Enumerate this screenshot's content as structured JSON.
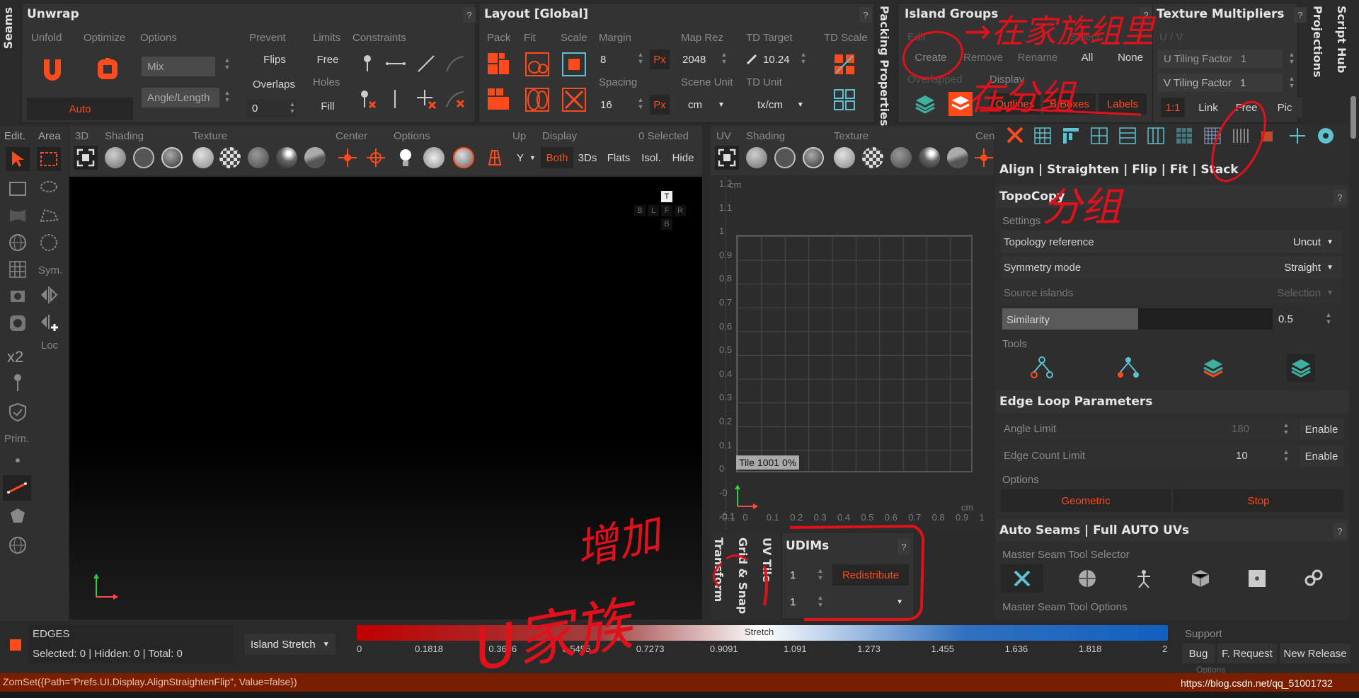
{
  "left_tabs": {
    "seams": "Seams"
  },
  "unwrap": {
    "title": "Unwrap",
    "unfold": "Unfold",
    "optimize": "Optimize",
    "options": "Options",
    "mix": "Mix",
    "angle_length": "Angle/Length",
    "auto": "Auto",
    "prevent": "Prevent",
    "flips": "Flips",
    "overlaps": "Overlaps",
    "overlaps_value": "0",
    "limits": "Limits",
    "free": "Free",
    "holes": "Holes",
    "fill": "Fill",
    "constraints": "Constraints",
    "help": "?"
  },
  "layout": {
    "title": "Layout [Global]",
    "pack": "Pack",
    "fit": "Fit",
    "scale": "Scale",
    "margin": "Margin",
    "margin_value": "8",
    "px": "Px",
    "spacing": "Spacing",
    "spacing_value": "16",
    "map_rez": "Map Rez",
    "map_rez_value": "2048",
    "scene_unit": "Scene Unit",
    "scene_unit_value": "cm",
    "td_target": "TD Target",
    "td_target_value": "10.24",
    "td_unit": "TD Unit",
    "td_unit_value": "tx/cm",
    "td_scale": "TD Scale",
    "help": "?"
  },
  "packing_properties": "Packing Properties",
  "island_groups": {
    "title": "Island Groups",
    "edit": "Edit",
    "select": "Select",
    "create": "Create",
    "remove": "Remove",
    "rename": "Rename",
    "all": "All",
    "none": "None",
    "overlapped": "Overlapped",
    "display": "Display",
    "outlines": "Outlines",
    "bboxes": "B.Boxes",
    "labels": "Labels",
    "help": "?"
  },
  "texture_multipliers": {
    "title": "Texture Multipliers",
    "uv_label": "U / V",
    "u_tiling": "U Tiling Factor",
    "u_value": "1",
    "v_tiling": "V Tiling Factor",
    "v_value": "1",
    "ratio": "1:1",
    "link": "Link",
    "free": "Free",
    "pic": "Pic",
    "help": "?"
  },
  "right_tabs": {
    "projections": "Projections",
    "script_hub": "Script Hub"
  },
  "tool_sidebar": {
    "edit": "Edit.",
    "area": "Area",
    "sym": "Sym.",
    "x2": "x2",
    "loc": "Loc",
    "prim": "Prim."
  },
  "view3d": {
    "label_3d": "3D",
    "shading": "Shading",
    "texture": "Texture",
    "center": "Center",
    "options": "Options",
    "up": "Up",
    "up_value": "Y",
    "display": "Display",
    "selected": "0 Selected",
    "both": "Both",
    "threeds": "3Ds",
    "flats": "Flats",
    "isol": "Isol.",
    "hide": "Hide",
    "gizmo_top": "T",
    "gizmo_mid": [
      "B",
      "L",
      "F",
      "R"
    ],
    "gizmo_bottom": "B"
  },
  "uv_view": {
    "uv": "UV",
    "shading": "Shading",
    "texture": "Texture",
    "center": "Cen",
    "unit": "cm",
    "y_ticks": [
      "1.2",
      "1.1",
      "1",
      "0.9",
      "0.8",
      "0.7",
      "0.6",
      "0.5",
      "0.4",
      "0.3",
      "0.2",
      "0.1",
      "0",
      "-0",
      "-0.1"
    ],
    "x_ticks": [
      "-0.1",
      "0",
      "0.1",
      "0.2",
      "0.3",
      "0.4",
      "0.5",
      "0.6",
      "0.7",
      "0.8",
      "0.9",
      "1"
    ],
    "x_unit": "cm",
    "tile_label": "Tile 1001 0%"
  },
  "uv_bottom_tabs": {
    "transform": "Transform",
    "grid_snap": "Grid & Snap",
    "uv_tile": "UV Tile"
  },
  "udims": {
    "title": "UDIMs",
    "value1": "1",
    "value2": "1",
    "redistribute": "Redistribute",
    "help": "?"
  },
  "right_panel": {
    "align_bar": "Align | Straighten | Flip | Fit | Stack",
    "topocopy": {
      "title": "TopoCopy",
      "settings": "Settings",
      "topology_reference": "Topology reference",
      "topology_value": "Uncut",
      "symmetry_mode": "Symmetry mode",
      "symmetry_value": "Straight",
      "source_islands": "Source islands",
      "source_value": "Selection",
      "similarity": "Similarity",
      "similarity_value": "0.5",
      "tools": "Tools",
      "help": "?"
    },
    "edge_loop": {
      "title": "Edge Loop Parameters",
      "angle_limit": "Angle Limit",
      "angle_value": "180",
      "edge_count_limit": "Edge Count Limit",
      "edge_count_value": "10",
      "enable": "Enable",
      "options": "Options",
      "geometric": "Geometric",
      "stop": "Stop"
    },
    "auto_seams": {
      "title": "Auto Seams | Full AUTO UVs",
      "master_selector": "Master Seam Tool Selector",
      "master_options": "Master Seam Tool Options",
      "help": "?"
    }
  },
  "status": {
    "mode": "EDGES",
    "counts": "Selected: 0 | Hidden: 0 | Total: 0",
    "island_stretch": "Island Stretch",
    "stretch": "Stretch",
    "stretch_ticks": [
      "0",
      "0.1818",
      "0.3636",
      "0.5455",
      "0.7273",
      "0.9091",
      "1.091",
      "1.273",
      "1.455",
      "1.636",
      "1.818",
      "2"
    ],
    "support": "Support",
    "bug": "Bug",
    "feature_request": "F. Request",
    "new_release": "New Release",
    "options": "Options"
  },
  "console": "ZomSet({Path=\"Prefs.UI.Display.AlignStraightenFlip\", Value=false})",
  "watermark": "https://blog.csdn.net/qq_51001732",
  "annotations": {
    "a1": "→在家族组里",
    "a2": "在分组",
    "a3": "分组",
    "a4": "增加",
    "a5": "U家族"
  },
  "colors": {
    "accent": "#ff4a1c",
    "annotation": "#e0111b",
    "panel": "#333333",
    "viewport": "#000000"
  }
}
